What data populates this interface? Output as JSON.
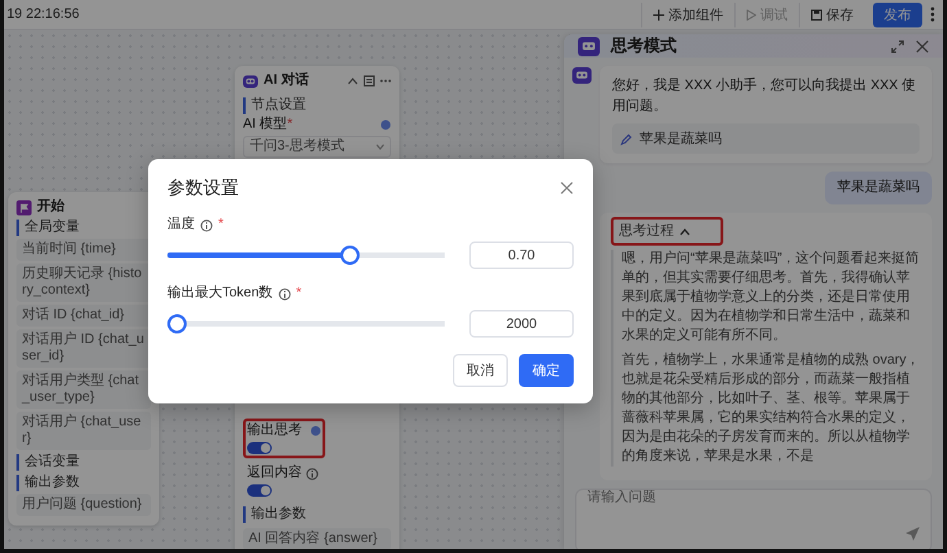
{
  "top_bar": {
    "time": "19 22:16:56",
    "actions": [
      {
        "kind": "add",
        "label": "添加组件",
        "disabled": false
      },
      {
        "kind": "run",
        "label": "调试",
        "disabled": true
      },
      {
        "kind": "save",
        "label": "保存",
        "disabled": false
      },
      {
        "kind": "primary",
        "label": "发布",
        "disabled": false
      }
    ]
  },
  "start_node": {
    "title": "开始",
    "sections": [
      {
        "label": "全局变量",
        "items": [
          "当前时间 {time}",
          "历史聊天记录 {history_context}",
          "对话 ID {chat_id}",
          "对话用户 ID {chat_user_id}",
          "对话用户类型 {chat_user_type}",
          "对话用户 {chat_user}"
        ]
      },
      {
        "label": "会话变量"
      },
      {
        "label": "输出参数",
        "items": [
          "用户问题 {question}"
        ]
      }
    ]
  },
  "ai_node": {
    "title": "AI 对话",
    "section": "节点设置",
    "model_label": "AI 模型",
    "model_required_mark": "*",
    "model_value": "千问3-思考模式",
    "settings": [
      {
        "label": "输出思考",
        "on": true,
        "help": true,
        "info": false,
        "highlighted": true
      },
      {
        "label": "返回内容",
        "on": true,
        "help": false,
        "info": true,
        "highlighted": false
      }
    ],
    "output_section": "输出参数",
    "outputs": [
      "AI 回答内容 {answer}"
    ]
  },
  "chat": {
    "title": "思考模式",
    "messages": [
      {
        "kind": "bot",
        "text": "您好，我是 XXX 小助手，您可以向我提出 XXX 使用问题。",
        "suggestion": "苹果是蔬菜吗"
      },
      {
        "kind": "user",
        "text": "苹果是蔬菜吗"
      },
      {
        "kind": "thinking",
        "header": "思考过程",
        "expanded": true,
        "highlighted": true,
        "paragraphs": [
          "嗯，用户问“苹果是蔬菜吗”，这个问题看起来挺简单的，但其实需要仔细思考。首先，我得确认苹果到底属于植物学意义上的分类，还是日常使用中的定义。因为在植物学和日常生活中，蔬菜和水果的定义可能有所不同。",
          "首先，植物学上，水果通常是植物的成熟 ovary，也就是花朵受精后形成的部分，而蔬菜一般指植物的其他部分，比如叶子、茎、根等。苹果属于蔷薇科苹果属，它的果实结构符合水果的定义，因为是由花朵的子房发育而来的。所以从植物学的角度来说，苹果是水果，不是"
        ]
      }
    ],
    "input": {
      "placeholder": "请输入问题"
    }
  },
  "modal": {
    "title": "参数设置",
    "fields": [
      {
        "label": "温度",
        "required_mark": "*",
        "level": 0.67,
        "value": "0.70"
      },
      {
        "label": "输出最大Token数",
        "required_mark": "*",
        "level": 0,
        "value": "2000"
      }
    ],
    "buttons": [
      {
        "label": "取消",
        "kind": "default"
      },
      {
        "label": "确定",
        "kind": "primary"
      }
    ]
  }
}
